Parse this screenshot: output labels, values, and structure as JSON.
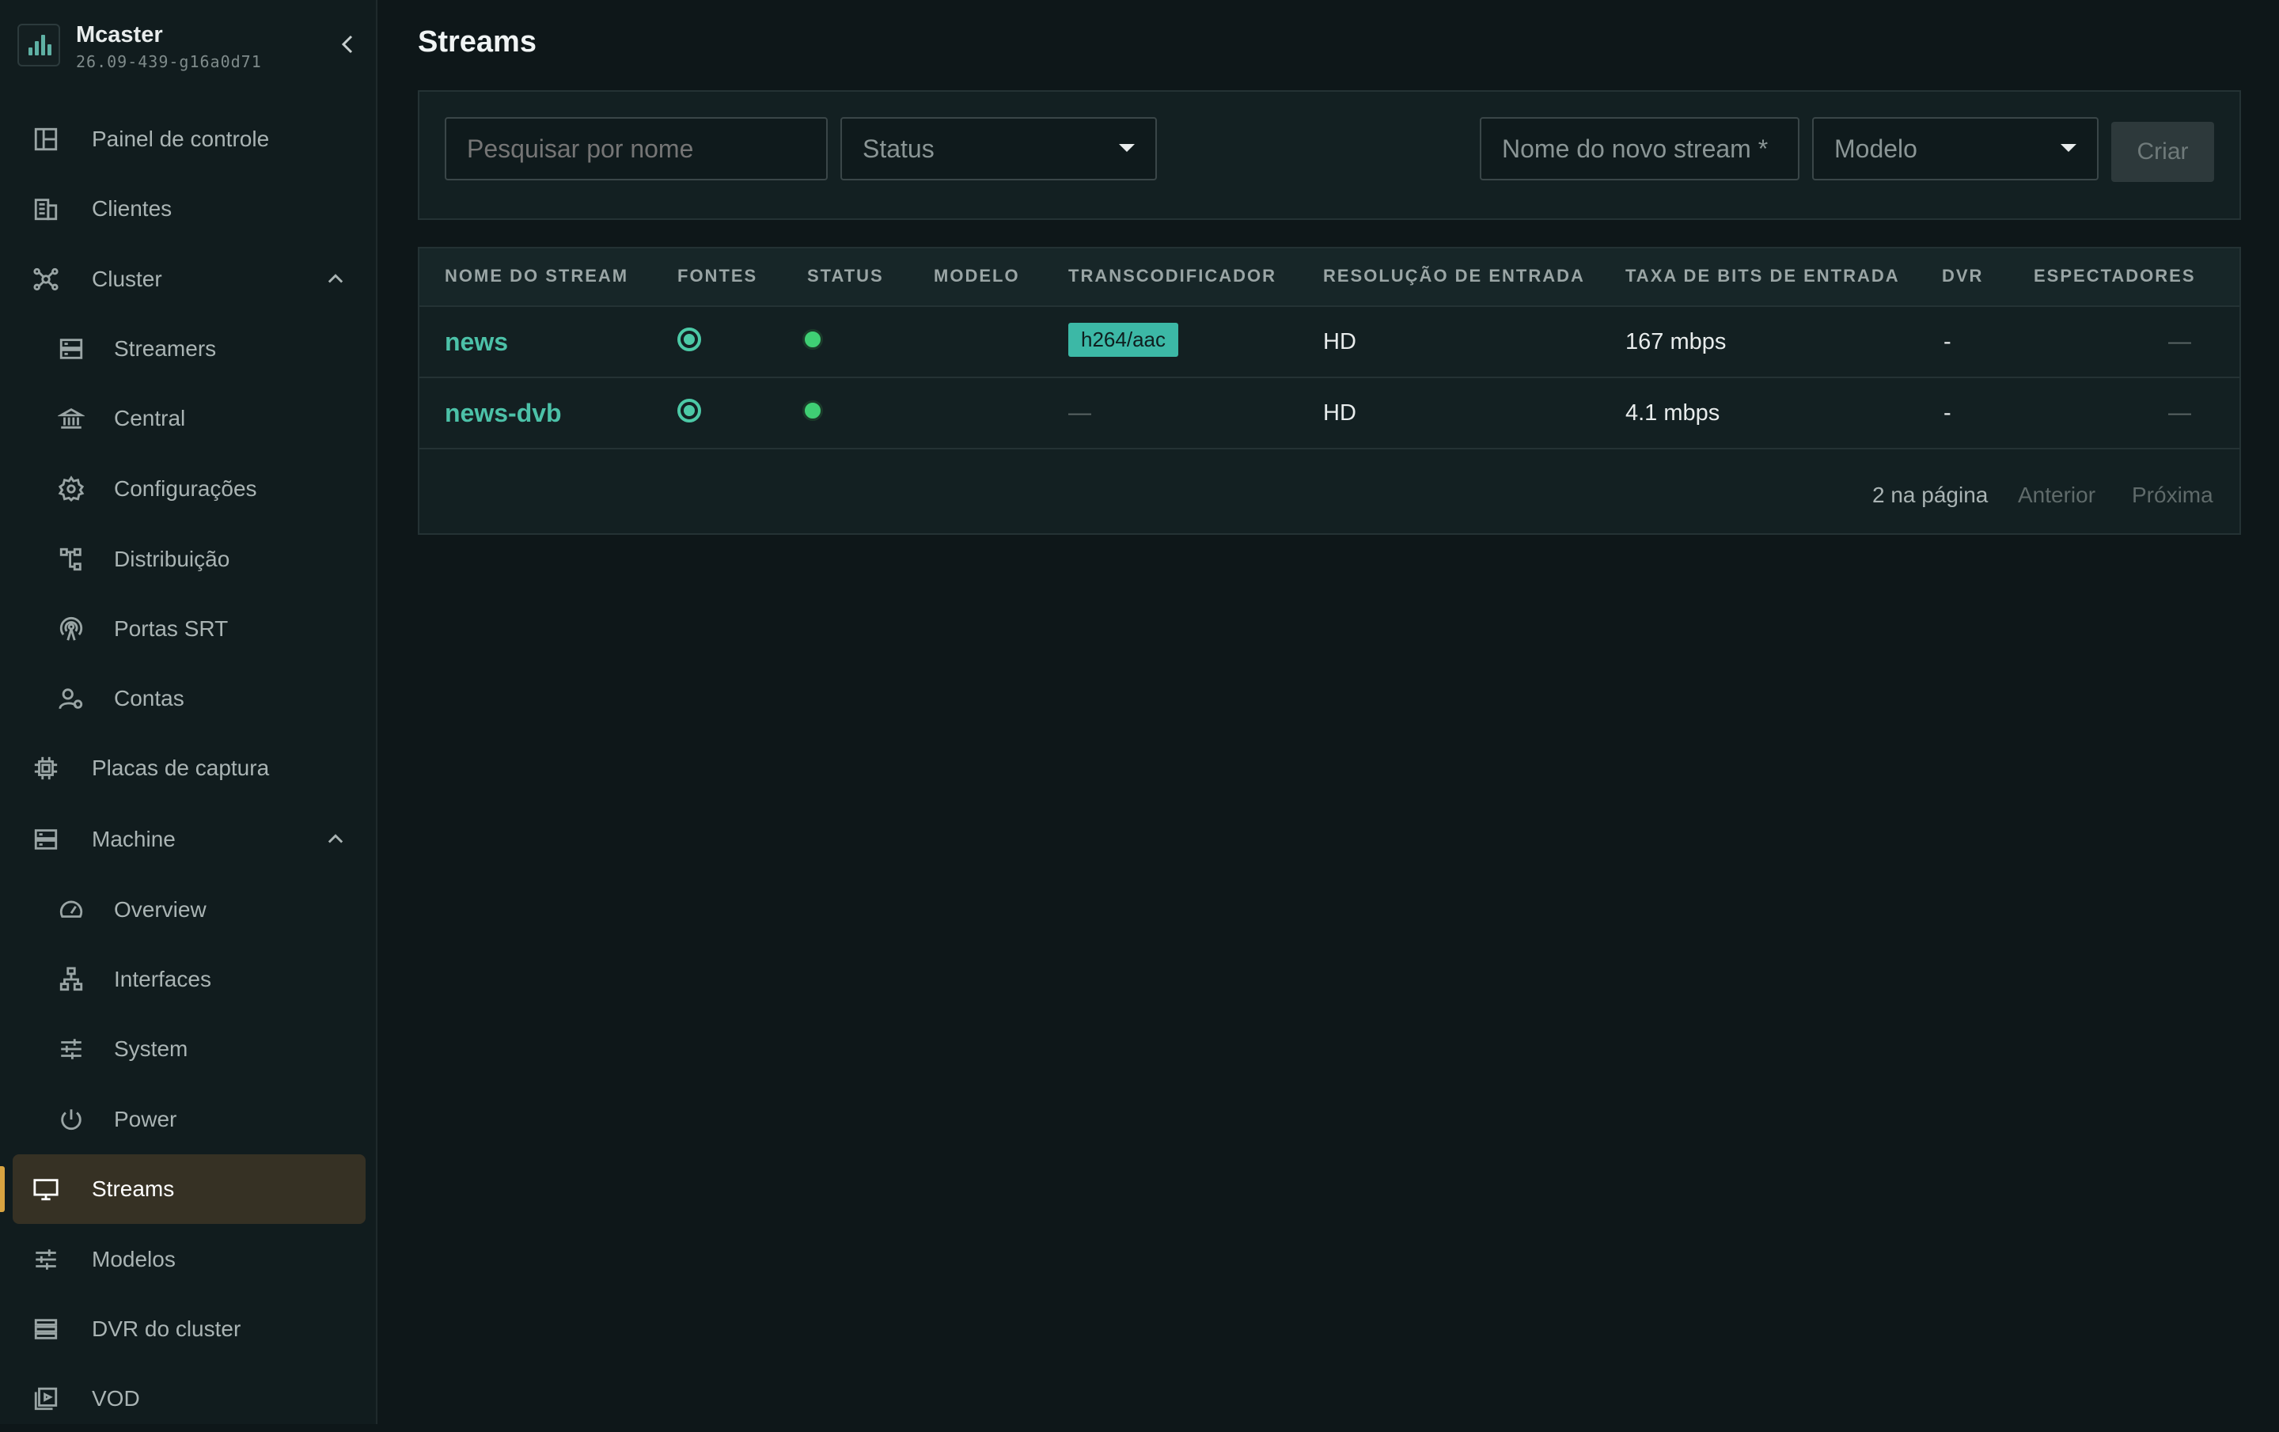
{
  "app": {
    "name": "Mcaster",
    "version": "26.09-439-g16a0d71"
  },
  "colors": {
    "accent": "#4cc1a8",
    "active_bar": "#d9a441",
    "active_bg": "#363124",
    "status_ok": "#3fcf74"
  },
  "sidebar": {
    "items": [
      {
        "label": "Painel de controle",
        "icon": "dashboard-icon"
      },
      {
        "label": "Clientes",
        "icon": "building-icon"
      },
      {
        "label": "Cluster",
        "icon": "cluster-icon",
        "expanded": true
      },
      {
        "label": "Streamers",
        "icon": "server-icon"
      },
      {
        "label": "Central",
        "icon": "bank-icon"
      },
      {
        "label": "Configurações",
        "icon": "gear-icon"
      },
      {
        "label": "Distribuição",
        "icon": "tree-icon"
      },
      {
        "label": "Portas SRT",
        "icon": "antenna-icon"
      },
      {
        "label": "Contas",
        "icon": "user-gear-icon"
      },
      {
        "label": "Placas de captura",
        "icon": "chip-icon"
      },
      {
        "label": "Machine",
        "icon": "machine-icon",
        "expanded": true
      },
      {
        "label": "Overview",
        "icon": "gauge-icon"
      },
      {
        "label": "Interfaces",
        "icon": "network-icon"
      },
      {
        "label": "System",
        "icon": "sliders-icon"
      },
      {
        "label": "Power",
        "icon": "power-icon"
      },
      {
        "label": "Streams",
        "icon": "monitor-icon",
        "active": true
      },
      {
        "label": "Modelos",
        "icon": "sliders-icon"
      },
      {
        "label": "DVR do cluster",
        "icon": "storage-icon"
      },
      {
        "label": "VOD",
        "icon": "video-icon"
      }
    ]
  },
  "main": {
    "title": "Streams",
    "search": {
      "placeholder": "Pesquisar por nome"
    },
    "status_filter": {
      "value": "Status"
    },
    "new_stream": {
      "placeholder": "Nome do novo stream *"
    },
    "template_select": {
      "value": "Modelo"
    },
    "create_label": "Criar"
  },
  "table": {
    "columns": [
      "NOME DO STREAM",
      "FONTES",
      "STATUS",
      "MODELO",
      "TRANSCODIFICADOR",
      "RESOLUÇÃO DE ENTRADA",
      "TAXA DE BITS DE ENTRADA",
      "DVR",
      "ESPECTADORES"
    ],
    "rows": [
      {
        "name": "news",
        "sources": "ok",
        "status": "ok",
        "template": "",
        "transcoder": "h264/aac",
        "resolution": "HD",
        "bitrate": "167 mbps",
        "dvr": "-",
        "viewers": "—"
      },
      {
        "name": "news-dvb",
        "sources": "ok",
        "status": "ok",
        "template": "",
        "transcoder": "—",
        "resolution": "HD",
        "bitrate": "4.1 mbps",
        "dvr": "-",
        "viewers": "—"
      }
    ],
    "pager": {
      "per_page": "2 na página",
      "prev": "Anterior",
      "next": "Próxima"
    }
  }
}
